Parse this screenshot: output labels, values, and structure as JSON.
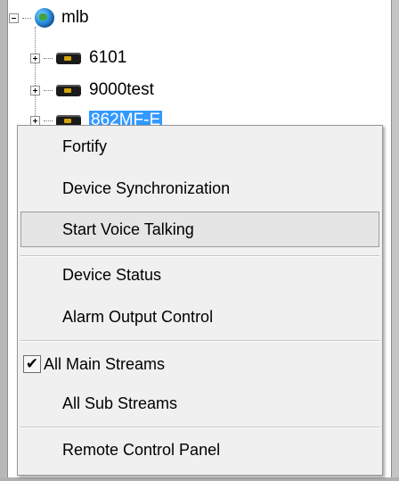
{
  "tree": {
    "root": {
      "label": "mlb",
      "icon": "globe-icon",
      "expander": "minus"
    },
    "children": [
      {
        "label": "6101",
        "icon": "dvr-device-icon",
        "expander": "plus",
        "selected": false
      },
      {
        "label": "9000test",
        "icon": "dvr-device-icon",
        "expander": "plus",
        "selected": false
      },
      {
        "label": "862MF-E",
        "icon": "dvr-device-icon",
        "expander": "plus",
        "selected": true
      }
    ]
  },
  "menu": {
    "items": [
      {
        "label": "Fortify"
      },
      {
        "label": "Device Synchronization"
      },
      {
        "label": "Start Voice Talking",
        "hovered": true
      },
      {
        "label": "Device Status"
      },
      {
        "label": "Alarm Output Control"
      },
      {
        "label": "All Main Streams",
        "checked": true,
        "check_glyph": "✔"
      },
      {
        "label": "All Sub Streams"
      },
      {
        "label": "Remote Control Panel"
      }
    ]
  },
  "colors": {
    "selection": "#3399ff",
    "menu_background": "#f0f0f0",
    "hover_background": "#e5e5e5"
  }
}
